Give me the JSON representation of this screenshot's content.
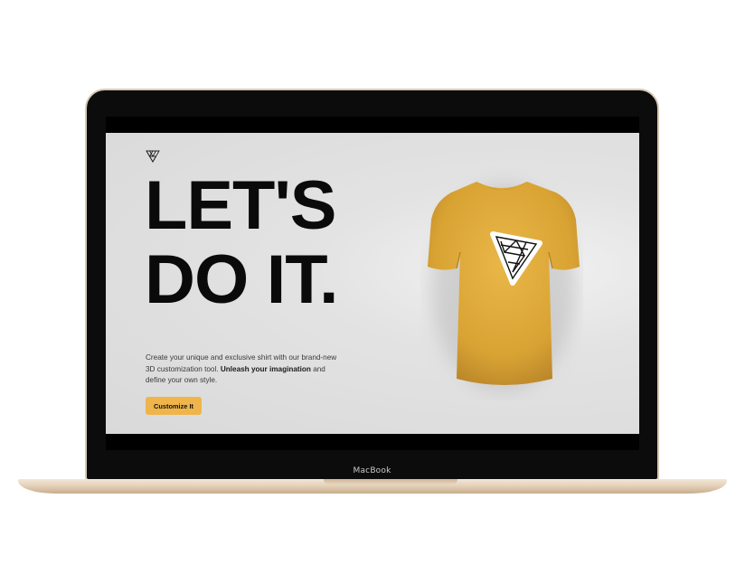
{
  "device": {
    "brand_label": "MacBook"
  },
  "hero": {
    "logo_icon": "triangle-logo-icon",
    "headline_line1": "LET'S",
    "headline_line2": "DO IT.",
    "description_part1": "Create your unique and exclusive shirt with our brand-new 3D customization tool. ",
    "description_emphasis": "Unleash your imagination",
    "description_part2": " and define your own style.",
    "cta_label": "Customize It"
  },
  "colors": {
    "accent": "#EFB54B",
    "shirt": "#E3AD3D",
    "background": "#DDDDDD",
    "text": "#0A0A0A"
  }
}
